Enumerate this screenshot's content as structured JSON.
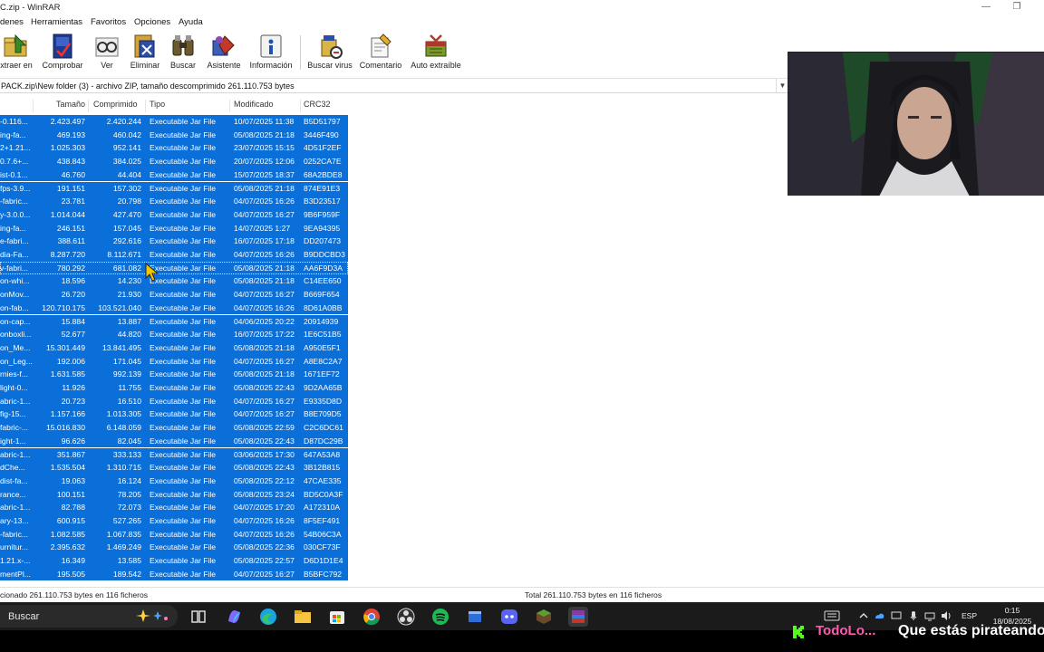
{
  "window": {
    "title": "C.zip - WinRAR",
    "controls": [
      "minimize",
      "restore"
    ]
  },
  "menu": [
    "denes",
    "Herramientas",
    "Favoritos",
    "Opciones",
    "Ayuda"
  ],
  "toolbar": [
    {
      "label": "xtraer en",
      "icon": "extract-icon"
    },
    {
      "label": "Comprobar",
      "icon": "test-icon"
    },
    {
      "label": "Ver",
      "icon": "view-icon"
    },
    {
      "label": "Eliminar",
      "icon": "delete-icon"
    },
    {
      "label": "Buscar",
      "icon": "find-icon"
    },
    {
      "label": "Asistente",
      "icon": "wizard-icon"
    },
    {
      "label": "Información",
      "icon": "info-icon"
    },
    {
      "label": "Buscar virus",
      "icon": "virus-scan-icon"
    },
    {
      "label": "Comentario",
      "icon": "comment-icon"
    },
    {
      "label": "Auto extraíble",
      "icon": "sfx-icon"
    }
  ],
  "path": "PACK.zip\\New folder (3) - archivo ZIP, tamaño descomprimido 261.110.753 bytes",
  "columns": {
    "size": "Tamaño",
    "packed": "Comprimido",
    "type": "Tipo",
    "modified": "Modificado",
    "crc": "CRC32"
  },
  "files": [
    {
      "name": "-0.116...",
      "size": "2.423.497",
      "packed": "2.420.244",
      "type": "Executable Jar File",
      "modified": "10/07/2025 11:38",
      "crc": "B5D51797"
    },
    {
      "name": "ing-fa...",
      "size": "469.193",
      "packed": "460.042",
      "type": "Executable Jar File",
      "modified": "05/08/2025 21:18",
      "crc": "3446F490"
    },
    {
      "name": "2+1.21...",
      "size": "1.025.303",
      "packed": "952.141",
      "type": "Executable Jar File",
      "modified": "23/07/2025 15:15",
      "crc": "4D51F2EF"
    },
    {
      "name": "0.7.6+...",
      "size": "438.843",
      "packed": "384.025",
      "type": "Executable Jar File",
      "modified": "20/07/2025 12:06",
      "crc": "0252CA7E"
    },
    {
      "name": "ist-0.1...",
      "size": "46.760",
      "packed": "44.404",
      "type": "Executable Jar File",
      "modified": "15/07/2025 18:37",
      "crc": "68A2BDE8"
    },
    {
      "name": "fps-3.9...",
      "size": "191.151",
      "packed": "157.302",
      "type": "Executable Jar File",
      "modified": "05/08/2025 21:18",
      "crc": "874E91E3"
    },
    {
      "name": "-fabric...",
      "size": "23.781",
      "packed": "20.798",
      "type": "Executable Jar File",
      "modified": "04/07/2025 16:26",
      "crc": "B3D23517"
    },
    {
      "name": "y-3.0.0...",
      "size": "1.014.044",
      "packed": "427.470",
      "type": "Executable Jar File",
      "modified": "04/07/2025 16:27",
      "crc": "9B6F959F"
    },
    {
      "name": "ing-fa...",
      "size": "246.151",
      "packed": "157.045",
      "type": "Executable Jar File",
      "modified": "14/07/2025 1:27",
      "crc": "9EA94395"
    },
    {
      "name": "e-fabri...",
      "size": "388.611",
      "packed": "292.616",
      "type": "Executable Jar File",
      "modified": "16/07/2025 17:18",
      "crc": "DD207473"
    },
    {
      "name": "dia-Fa...",
      "size": "8.287.720",
      "packed": "8.112.671",
      "type": "Executable Jar File",
      "modified": "04/07/2025 16:26",
      "crc": "B9DDCBD3"
    },
    {
      "name": "v-fabri...",
      "size": "780.292",
      "packed": "681.082",
      "type": "Executable Jar File",
      "modified": "05/08/2025 21:18",
      "crc": "AA6F9D3A"
    },
    {
      "name": "on-whi...",
      "size": "18.596",
      "packed": "14.230",
      "type": "Executable Jar File",
      "modified": "05/08/2025 21:18",
      "crc": "C14EE650"
    },
    {
      "name": "onMov...",
      "size": "26.720",
      "packed": "21.930",
      "type": "Executable Jar File",
      "modified": "04/07/2025 16:27",
      "crc": "B669F654"
    },
    {
      "name": "on-fab...",
      "size": "120.710.175",
      "packed": "103.521.040",
      "type": "Executable Jar File",
      "modified": "04/07/2025 16:26",
      "crc": "8D61A0BB"
    },
    {
      "name": "on-cap...",
      "size": "15.884",
      "packed": "13.887",
      "type": "Executable Jar File",
      "modified": "04/06/2025 20:22",
      "crc": "20914939"
    },
    {
      "name": "onboxli...",
      "size": "52.677",
      "packed": "44.820",
      "type": "Executable Jar File",
      "modified": "16/07/2025 17:22",
      "crc": "1E6C51B5"
    },
    {
      "name": "on_Me...",
      "size": "15.301.449",
      "packed": "13.841.495",
      "type": "Executable Jar File",
      "modified": "05/08/2025 21:18",
      "crc": "A950E5F1"
    },
    {
      "name": "on_Leg...",
      "size": "192.006",
      "packed": "171.045",
      "type": "Executable Jar File",
      "modified": "04/07/2025 16:27",
      "crc": "A8E8C2A7"
    },
    {
      "name": "rnies-f...",
      "size": "1.631.585",
      "packed": "992.139",
      "type": "Executable Jar File",
      "modified": "05/08/2025 21:18",
      "crc": "1671EF72"
    },
    {
      "name": "light-0...",
      "size": "11.926",
      "packed": "11.755",
      "type": "Executable Jar File",
      "modified": "05/08/2025 22:43",
      "crc": "9D2AA65B"
    },
    {
      "name": "abric-1...",
      "size": "20.723",
      "packed": "16.510",
      "type": "Executable Jar File",
      "modified": "04/07/2025 16:27",
      "crc": "E9335D8D"
    },
    {
      "name": "fig-15...",
      "size": "1.157.166",
      "packed": "1.013.305",
      "type": "Executable Jar File",
      "modified": "04/07/2025 16:27",
      "crc": "B8E709D5"
    },
    {
      "name": "fabric-...",
      "size": "15.016.830",
      "packed": "6.148.059",
      "type": "Executable Jar File",
      "modified": "05/08/2025 22:59",
      "crc": "C2C6DC61"
    },
    {
      "name": "ight-1...",
      "size": "96.626",
      "packed": "82.045",
      "type": "Executable Jar File",
      "modified": "05/08/2025 22:43",
      "crc": "D87DC29B"
    },
    {
      "name": "abric-1...",
      "size": "351.867",
      "packed": "333.133",
      "type": "Executable Jar File",
      "modified": "03/06/2025 17:30",
      "crc": "647A53A8"
    },
    {
      "name": "dChe...",
      "size": "1.535.504",
      "packed": "1.310.715",
      "type": "Executable Jar File",
      "modified": "05/08/2025 22:43",
      "crc": "3B12B815"
    },
    {
      "name": "dist-fa...",
      "size": "19.063",
      "packed": "16.124",
      "type": "Executable Jar File",
      "modified": "05/08/2025 22:12",
      "crc": "47CAE335"
    },
    {
      "name": "rance...",
      "size": "100.151",
      "packed": "78.205",
      "type": "Executable Jar File",
      "modified": "05/08/2025 23:24",
      "crc": "BD5C0A3F"
    },
    {
      "name": "abric-1...",
      "size": "82.788",
      "packed": "72.073",
      "type": "Executable Jar File",
      "modified": "04/07/2025 17:20",
      "crc": "A172310A"
    },
    {
      "name": "ary-13...",
      "size": "600.915",
      "packed": "527.265",
      "type": "Executable Jar File",
      "modified": "04/07/2025 16:26",
      "crc": "8F5EF491"
    },
    {
      "name": "-fabric...",
      "size": "1.082.585",
      "packed": "1.067.835",
      "type": "Executable Jar File",
      "modified": "04/07/2025 16:26",
      "crc": "54B06C3A"
    },
    {
      "name": "urnitur...",
      "size": "2.395.632",
      "packed": "1.469.249",
      "type": "Executable Jar File",
      "modified": "05/08/2025 22:36",
      "crc": "030CF73F"
    },
    {
      "name": "1.21.x-...",
      "size": "16.349",
      "packed": "13.585",
      "type": "Executable Jar File",
      "modified": "05/08/2025 22:57",
      "crc": "D6D1D1E4"
    },
    {
      "name": "mentPl...",
      "size": "195.505",
      "packed": "189.542",
      "type": "Executable Jar File",
      "modified": "04/07/2025 16:27",
      "crc": "B5BFC792"
    }
  ],
  "status": {
    "selected": "cionado 261.110.753 bytes en 116 ficheros",
    "total": "Total 261.110.753 bytes en 116 ficheros"
  },
  "taskbar": {
    "search_label": "Buscar",
    "lang": "ESP",
    "time": "0:15",
    "date": "18/08/2025",
    "apps": [
      "task-view",
      "copilot",
      "edge",
      "file-explorer",
      "store",
      "chrome",
      "obs",
      "spotify",
      "app-window",
      "discord",
      "minecraft",
      "winrar"
    ]
  },
  "overlay": {
    "channel": "TodoLo...",
    "caption": "Que estás pirateando"
  }
}
